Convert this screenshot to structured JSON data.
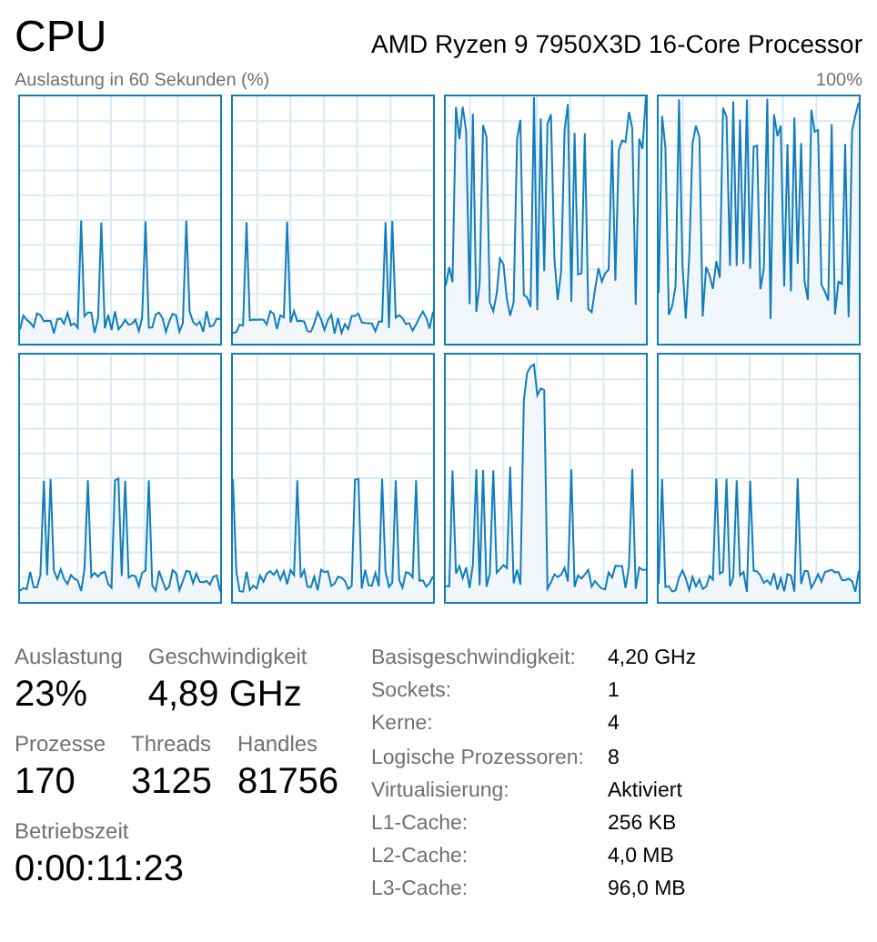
{
  "header": {
    "title": "CPU",
    "processor": "AMD Ryzen 9 7950X3D 16-Core Processor"
  },
  "graph": {
    "label": "Auslastung in 60 Sekunden (%)",
    "max": "100%"
  },
  "stats": [
    [
      {
        "label": "Auslastung",
        "value": "23%"
      },
      {
        "label": "Geschwindigkeit",
        "value": "4,89 GHz"
      }
    ],
    [
      {
        "label": "Prozesse",
        "value": "170"
      },
      {
        "label": "Threads",
        "value": "3125"
      },
      {
        "label": "Handles",
        "value": "81756"
      }
    ],
    [
      {
        "label": "Betriebszeit",
        "value": "0:00:11:23"
      }
    ]
  ],
  "details": [
    {
      "label": "Basisgeschwindigkeit:",
      "value": "4,20 GHz"
    },
    {
      "label": "Sockets:",
      "value": "1"
    },
    {
      "label": "Kerne:",
      "value": "4"
    },
    {
      "label": "Logische Prozessoren:",
      "value": "8"
    },
    {
      "label": "Virtualisierung:",
      "value": "Aktiviert"
    },
    {
      "label": "L1-Cache:",
      "value": "256 KB"
    },
    {
      "label": "L2-Cache:",
      "value": "4,0 MB"
    },
    {
      "label": "L3-Cache:",
      "value": "96,0 MB"
    }
  ]
}
